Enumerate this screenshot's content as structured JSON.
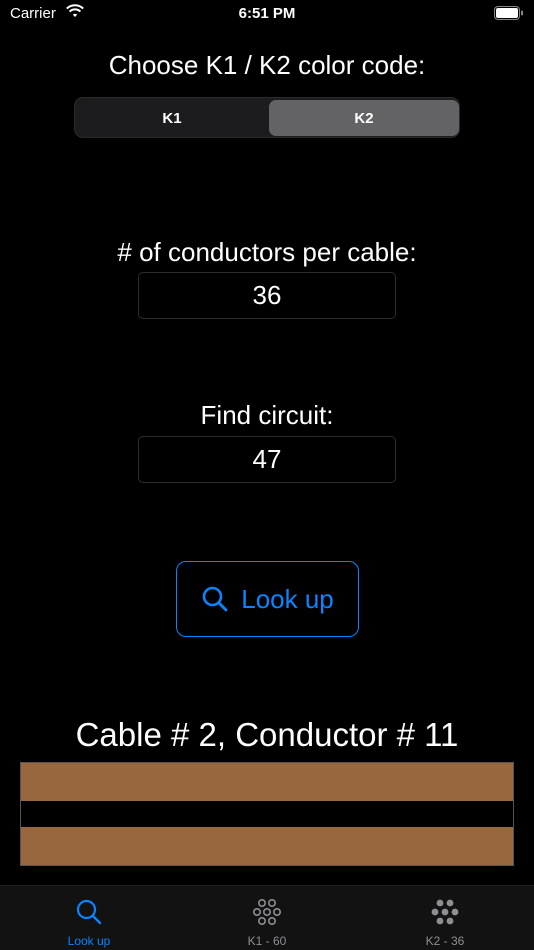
{
  "status_bar": {
    "carrier": "Carrier",
    "time": "6:51 PM"
  },
  "color_code": {
    "title": "Choose K1 / K2 color code:",
    "options": [
      "K1",
      "K2"
    ],
    "selected": "K2"
  },
  "conductors": {
    "label": "# of conductors per cable:",
    "value": "36"
  },
  "circuit": {
    "label": "Find circuit:",
    "value": "47"
  },
  "lookup_button": {
    "label": "Look up",
    "icon": "search-icon"
  },
  "result": {
    "title": "Cable # 2, Conductor # 11",
    "stripe_colors": [
      "#99673e",
      "#000000",
      "#99673e"
    ]
  },
  "tab_bar": {
    "tabs": [
      {
        "label": "Look up",
        "icon": "search-icon",
        "active": true
      },
      {
        "label": "K1 - 60",
        "icon": "cable-bundle-outline-icon",
        "active": false
      },
      {
        "label": "K2 - 36",
        "icon": "cable-bundle-filled-icon",
        "active": false
      }
    ]
  },
  "colors": {
    "accent": "#0a84ff",
    "background": "#000000",
    "segment_selected": "#636366",
    "inactive_tab": "#8e8e93"
  }
}
